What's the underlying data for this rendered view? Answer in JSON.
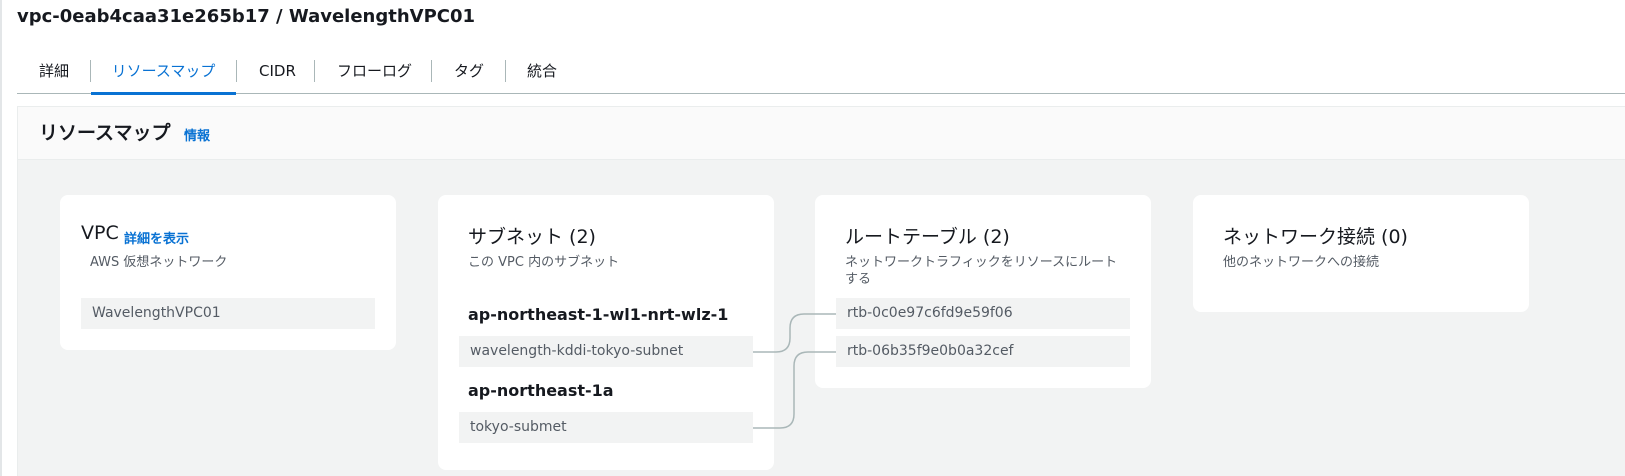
{
  "header": {
    "title": "vpc-0eab4caa31e265b17 / WavelengthVPC01"
  },
  "tabs": [
    {
      "label": "詳細"
    },
    {
      "label": "リソースマップ",
      "active": true
    },
    {
      "label": "CIDR"
    },
    {
      "label": "フローログ"
    },
    {
      "label": "タグ"
    },
    {
      "label": "統合"
    }
  ],
  "resource_map": {
    "title": "リソースマップ",
    "info_link": "情報",
    "vpc_card": {
      "title": "VPC",
      "detail_link": "詳細を表示",
      "description": "AWS 仮想ネットワーク",
      "vpc_name": "WavelengthVPC01"
    },
    "subnet_card": {
      "title": "サブネット (2)",
      "description": "この VPC 内のサブネット",
      "groups": [
        {
          "zone": "ap-northeast-1-wl1-nrt-wlz-1",
          "subnet": "wavelength-kddi-tokyo-subnet"
        },
        {
          "zone": "ap-northeast-1a",
          "subnet": "tokyo-submet"
        }
      ]
    },
    "route_card": {
      "title": "ルートテーブル (2)",
      "description": "ネットワークトラフィックをリソースにルートする",
      "tables": [
        "rtb-0c0e97c6fd9e59f06",
        "rtb-06b35f9e0b0a32cef"
      ]
    },
    "network_card": {
      "title": "ネットワーク接続 (0)",
      "description": "他のネットワークへの接続"
    }
  },
  "colors": {
    "accent": "#0972d3",
    "connector": "#aab7b8"
  }
}
